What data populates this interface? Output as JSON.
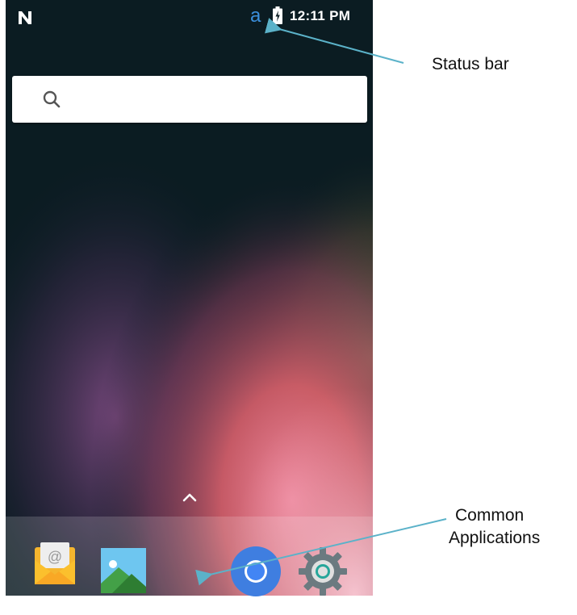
{
  "status_bar": {
    "notification_letter": "a",
    "time": "12:11 PM"
  },
  "search": {
    "placeholder": ""
  },
  "dock": {
    "apps": [
      {
        "name": "email",
        "icon": "email-icon"
      },
      {
        "name": "gallery",
        "icon": "gallery-icon"
      },
      {
        "name": "chrome",
        "icon": "chrome-icon"
      },
      {
        "name": "settings",
        "icon": "settings-icon"
      }
    ]
  },
  "annotations": {
    "status_bar_label": "Status bar",
    "common_apps_line1": "Common",
    "common_apps_line2": "Applications"
  },
  "colors": {
    "annotation_arrow": "#5bb2c9",
    "notification_blue": "#3b8fdc"
  }
}
